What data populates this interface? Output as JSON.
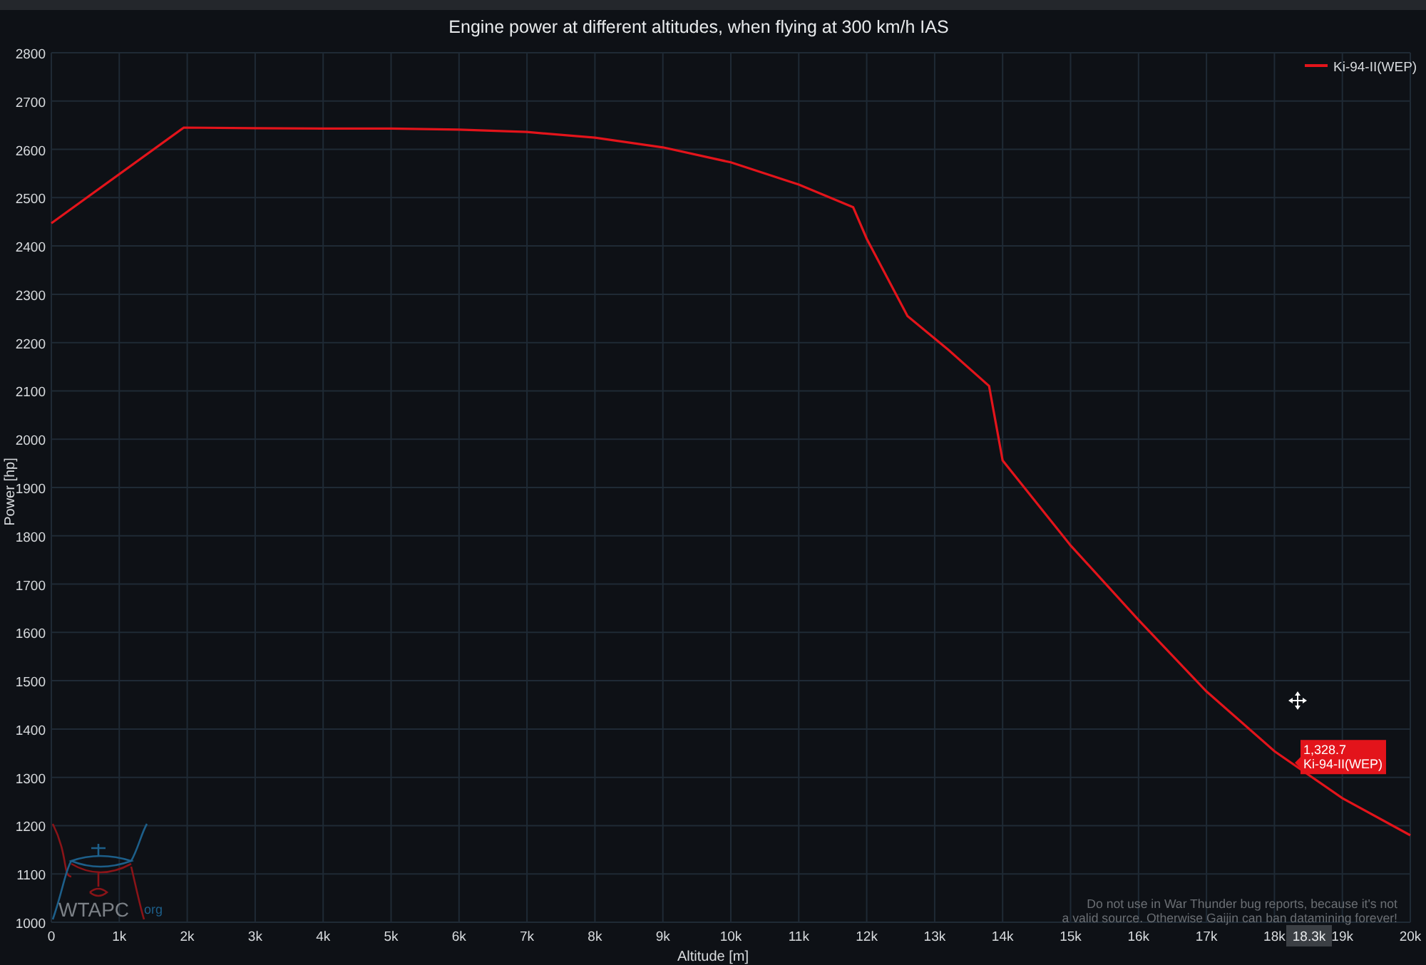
{
  "chart": {
    "chart_data": {
      "type": "line",
      "title": "Engine power at different altitudes, when flying at 300 km/h IAS",
      "xlabel": "Altitude [m]",
      "ylabel": "Power [hp]",
      "grid": true,
      "x": [
        0,
        1950,
        3000,
        4000,
        5000,
        6000,
        7000,
        8000,
        9000,
        10000,
        11000,
        11800,
        12000,
        12600,
        13200,
        13800,
        14000,
        15000,
        16000,
        17000,
        18000,
        19000,
        20000
      ],
      "series": [
        {
          "name": "Ki-94-II(WEP)",
          "color": "#e3141b",
          "values": [
            2447,
            2645,
            2644,
            2643,
            2643,
            2641,
            2636,
            2624,
            2604,
            2573,
            2527,
            2480,
            2415,
            2255,
            2185,
            2110,
            1956,
            1780,
            1626,
            1478,
            1354,
            1257,
            1180
          ]
        }
      ],
      "xlim": [
        0,
        20000
      ],
      "ylim": [
        1000,
        2800
      ],
      "xticks": [
        {
          "value": 0,
          "label": "0"
        },
        {
          "value": 1000,
          "label": "1k"
        },
        {
          "value": 2000,
          "label": "2k"
        },
        {
          "value": 3000,
          "label": "3k"
        },
        {
          "value": 4000,
          "label": "4k"
        },
        {
          "value": 5000,
          "label": "5k"
        },
        {
          "value": 6000,
          "label": "6k"
        },
        {
          "value": 7000,
          "label": "7k"
        },
        {
          "value": 8000,
          "label": "8k"
        },
        {
          "value": 9000,
          "label": "9k"
        },
        {
          "value": 10000,
          "label": "10k"
        },
        {
          "value": 11000,
          "label": "11k"
        },
        {
          "value": 12000,
          "label": "12k"
        },
        {
          "value": 13000,
          "label": "13k"
        },
        {
          "value": 14000,
          "label": "14k"
        },
        {
          "value": 15000,
          "label": "15k"
        },
        {
          "value": 16000,
          "label": "16k"
        },
        {
          "value": 17000,
          "label": "17k"
        },
        {
          "value": 18000,
          "label": "18k"
        },
        {
          "value": 19000,
          "label": "19k"
        },
        {
          "value": 20000,
          "label": "20k"
        }
      ],
      "yticks": [
        1000,
        1100,
        1200,
        1300,
        1400,
        1500,
        1600,
        1700,
        1800,
        1900,
        2000,
        2100,
        2200,
        2300,
        2400,
        2500,
        2600,
        2700,
        2800
      ]
    },
    "tooltip": {
      "value": "1,328.7",
      "series_name": "Ki-94-II(WEP)",
      "x_label": "18.3k"
    },
    "watermark": {
      "text": "WTAPC",
      "suffix": "org"
    },
    "disclaimer": [
      "Do not use in War Thunder bug reports, because it's not",
      "a valid source. Otherwise Gaijin can ban datamining forever!"
    ]
  }
}
